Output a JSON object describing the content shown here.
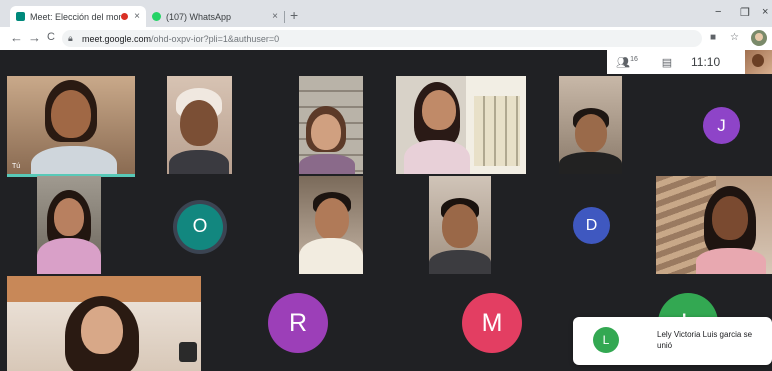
{
  "browser": {
    "tabs": [
      {
        "title": "Meet: Elección del monitor",
        "recording": true,
        "close": "×",
        "favicon": "meet-icon"
      },
      {
        "title": "(107) WhatsApp",
        "close": "×",
        "favicon": "whatsapp-icon"
      }
    ],
    "new_tab": "+",
    "window_controls": {
      "minimize": "−",
      "restore": "❐",
      "close": "×"
    },
    "nav": {
      "back": "←",
      "forward": "→",
      "reload": "C"
    },
    "address": {
      "host": "meet.google.com",
      "path": "/ohd-oxpv-ior?pli=1&authuser=0"
    },
    "toolbar_icons": [
      "camera-icon",
      "star-icon"
    ]
  },
  "meet": {
    "top_bar": {
      "participants_count": "16",
      "time": "11:10"
    },
    "participants": [
      {
        "kind": "video",
        "id": "girl-top-left"
      },
      {
        "kind": "video",
        "id": "boy-cap"
      },
      {
        "kind": "video",
        "id": "girl-shelves"
      },
      {
        "kind": "video",
        "id": "girl-windows"
      },
      {
        "kind": "video",
        "id": "boy-dark"
      },
      {
        "kind": "avatar",
        "letter": "J",
        "color": "#8e44c8"
      },
      {
        "kind": "video",
        "id": "girl-pink"
      },
      {
        "kind": "avatar",
        "letter": "O",
        "color": "#12877f"
      },
      {
        "kind": "video",
        "id": "boy-white-shirt"
      },
      {
        "kind": "video",
        "id": "boy-center"
      },
      {
        "kind": "avatar",
        "letter": "D",
        "color": "#3f58c0"
      },
      {
        "kind": "video",
        "id": "girl-right"
      },
      {
        "kind": "video",
        "id": "girl-curly"
      },
      {
        "kind": "avatar",
        "letter": "R",
        "color": "#9c3fb8"
      },
      {
        "kind": "avatar",
        "letter": "M",
        "color": "#e33e62"
      },
      {
        "kind": "avatar",
        "letter": "L",
        "color": "#33a852"
      }
    ],
    "active_speaker_label": "Tú",
    "toast": {
      "letter": "L",
      "message": "Lely Victoria Luis garcia se unió"
    }
  }
}
